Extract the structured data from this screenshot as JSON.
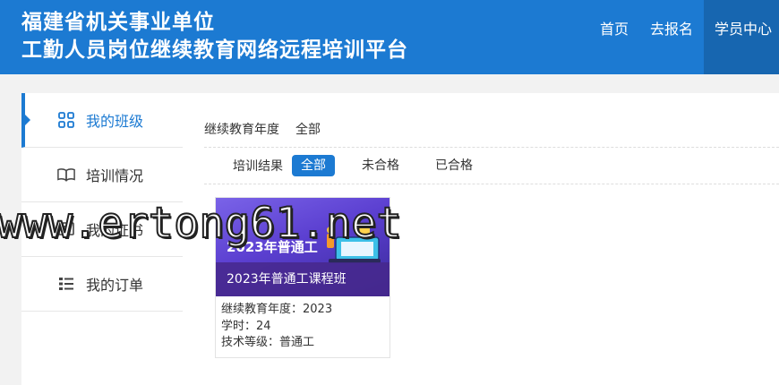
{
  "header": {
    "title_line1": "福建省机关事业单位",
    "title_line2": "工勤人员岗位继续教育网络远程培训平台",
    "nav": [
      {
        "label": "首页",
        "active": false
      },
      {
        "label": "去报名",
        "active": false
      },
      {
        "label": "学员中心",
        "active": true
      }
    ]
  },
  "sidebar": {
    "items": [
      {
        "label": "我的班级",
        "icon": "grid-icon",
        "active": true
      },
      {
        "label": "培训情况",
        "icon": "book-icon",
        "active": false
      },
      {
        "label": "我的证书",
        "icon": "certificate-icon",
        "active": false
      },
      {
        "label": "我的订单",
        "icon": "list-icon",
        "active": false
      }
    ]
  },
  "filters": {
    "year": {
      "label": "继续教育年度",
      "value": "全部"
    },
    "result": {
      "label": "培训结果",
      "options": [
        "全部",
        "未合格",
        "已合格"
      ],
      "selected": "全部"
    }
  },
  "course": {
    "thumb_tag": "2023年普通工",
    "title": "2023年普通工课程班",
    "year_line": "继续教育年度：2023",
    "hours_line": "学时：24",
    "level_line": "技术等级：普通工"
  },
  "watermark": "www.ertong61.net",
  "colors": {
    "primary": "#1c7ad2",
    "nav_active": "#1766b0"
  }
}
